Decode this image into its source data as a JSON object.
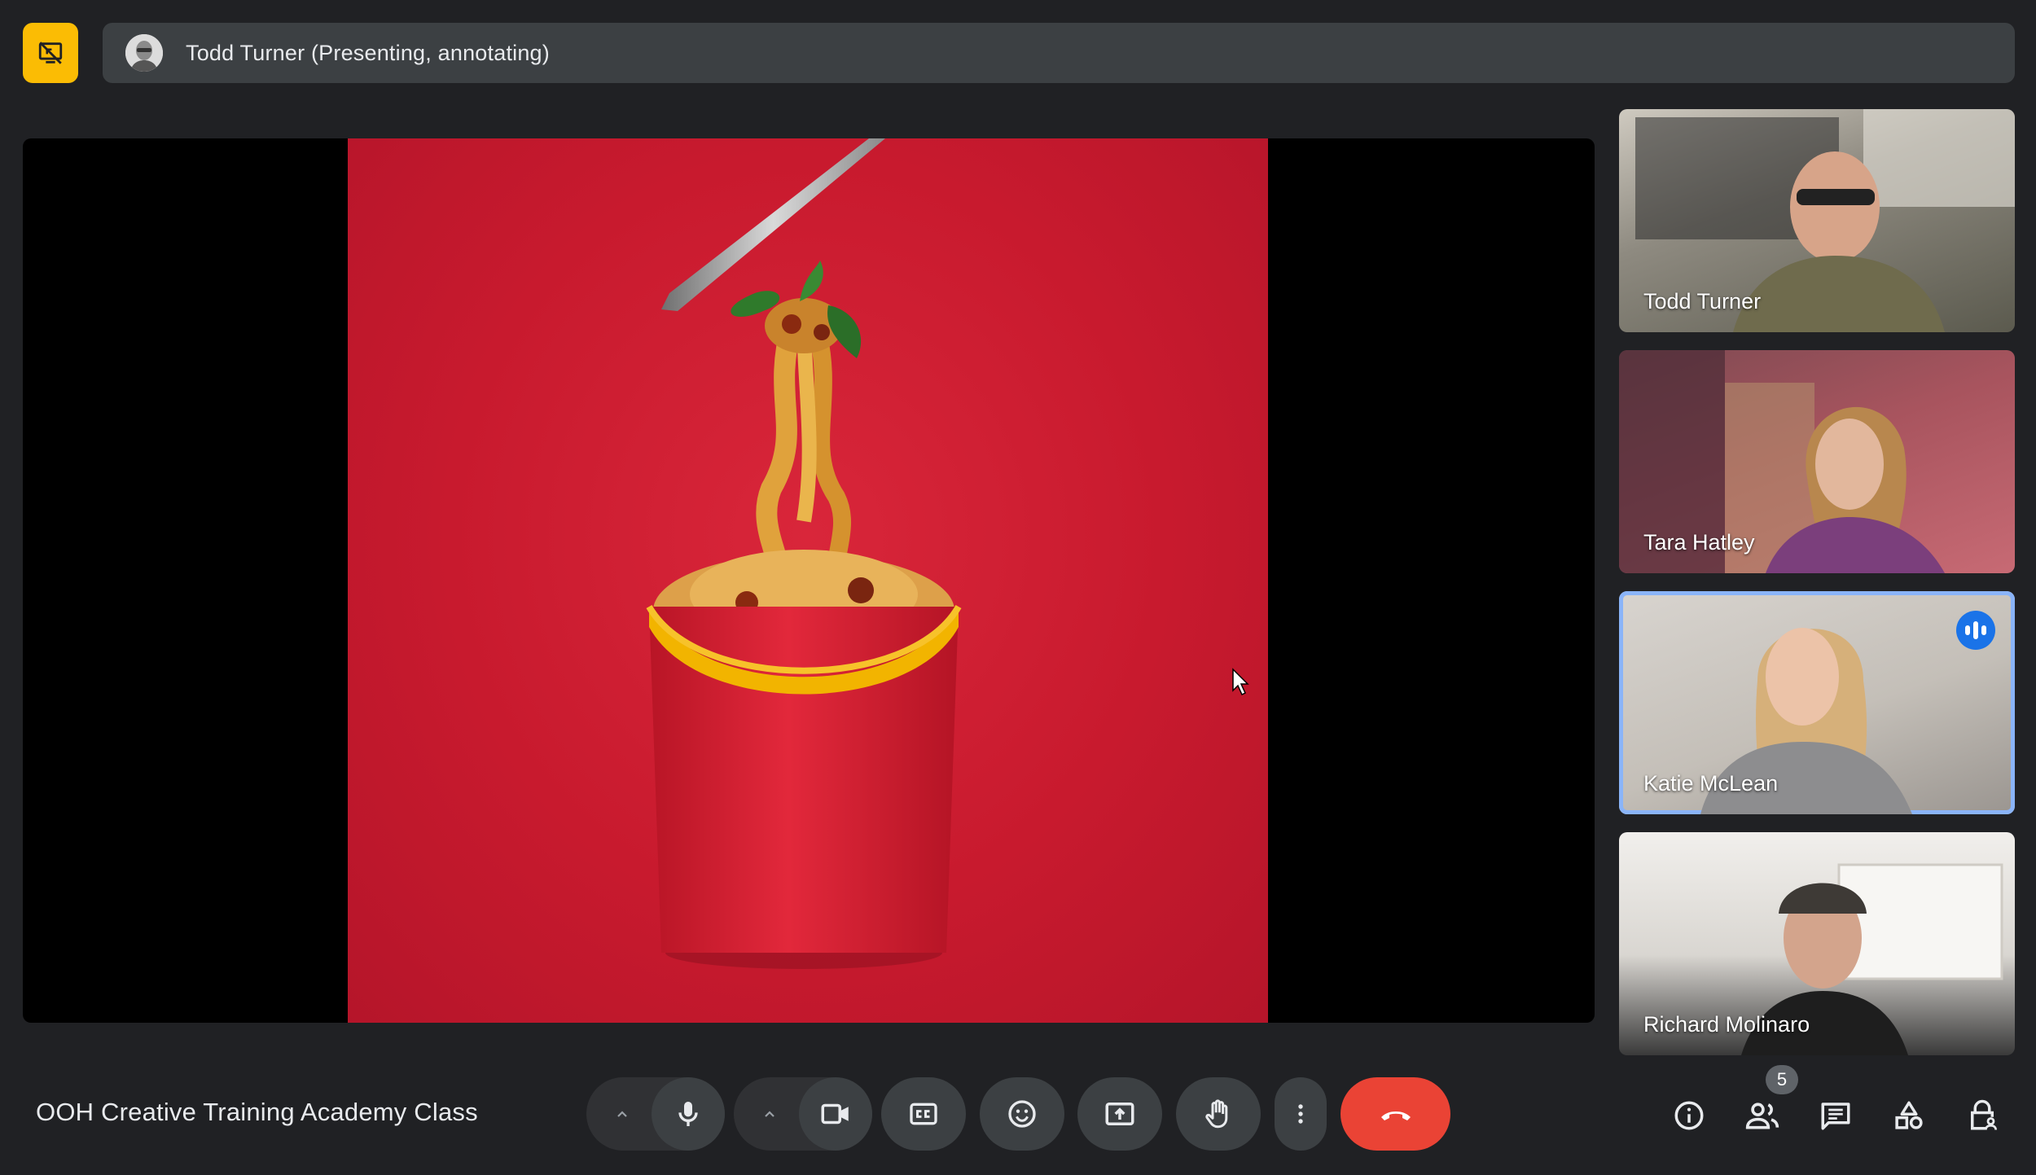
{
  "header": {
    "presenter_label": "Todd Turner (Presenting, annotating)",
    "badge_icon": "stop-presenting-icon"
  },
  "participants": [
    {
      "name": "Todd Turner",
      "speaking": false
    },
    {
      "name": "Tara Hatley",
      "speaking": false
    },
    {
      "name": "Katie McLean",
      "speaking": true
    },
    {
      "name": "Richard Molinaro",
      "speaking": false
    }
  ],
  "footer": {
    "meeting_title": "OOH Creative Training Academy Class",
    "participant_count": "5"
  },
  "controls": [
    {
      "name": "audio-options-chevron",
      "icon": "chevron-up-icon"
    },
    {
      "name": "microphone-button",
      "icon": "mic-icon"
    },
    {
      "name": "video-options-chevron",
      "icon": "chevron-up-icon"
    },
    {
      "name": "camera-button",
      "icon": "video-camera-icon"
    },
    {
      "name": "captions-button",
      "icon": "closed-captions-icon"
    },
    {
      "name": "reactions-button",
      "icon": "emoji-icon"
    },
    {
      "name": "present-button",
      "icon": "present-screen-icon"
    },
    {
      "name": "raise-hand-button",
      "icon": "hand-icon"
    },
    {
      "name": "more-options-button",
      "icon": "more-vert-icon"
    },
    {
      "name": "leave-call-button",
      "icon": "hang-up-icon"
    }
  ],
  "right_controls": [
    {
      "name": "meeting-info-button",
      "icon": "info-icon"
    },
    {
      "name": "people-button",
      "icon": "people-icon"
    },
    {
      "name": "chat-button",
      "icon": "chat-icon"
    },
    {
      "name": "activities-button",
      "icon": "activities-icon"
    },
    {
      "name": "host-controls-button",
      "icon": "lock-person-icon"
    }
  ],
  "colors": {
    "background": "#202124",
    "accent_badge": "#fbbc04",
    "hangup": "#ea4335",
    "speaking_blue": "#1a73e8",
    "slide_red": "#c81a2e"
  }
}
